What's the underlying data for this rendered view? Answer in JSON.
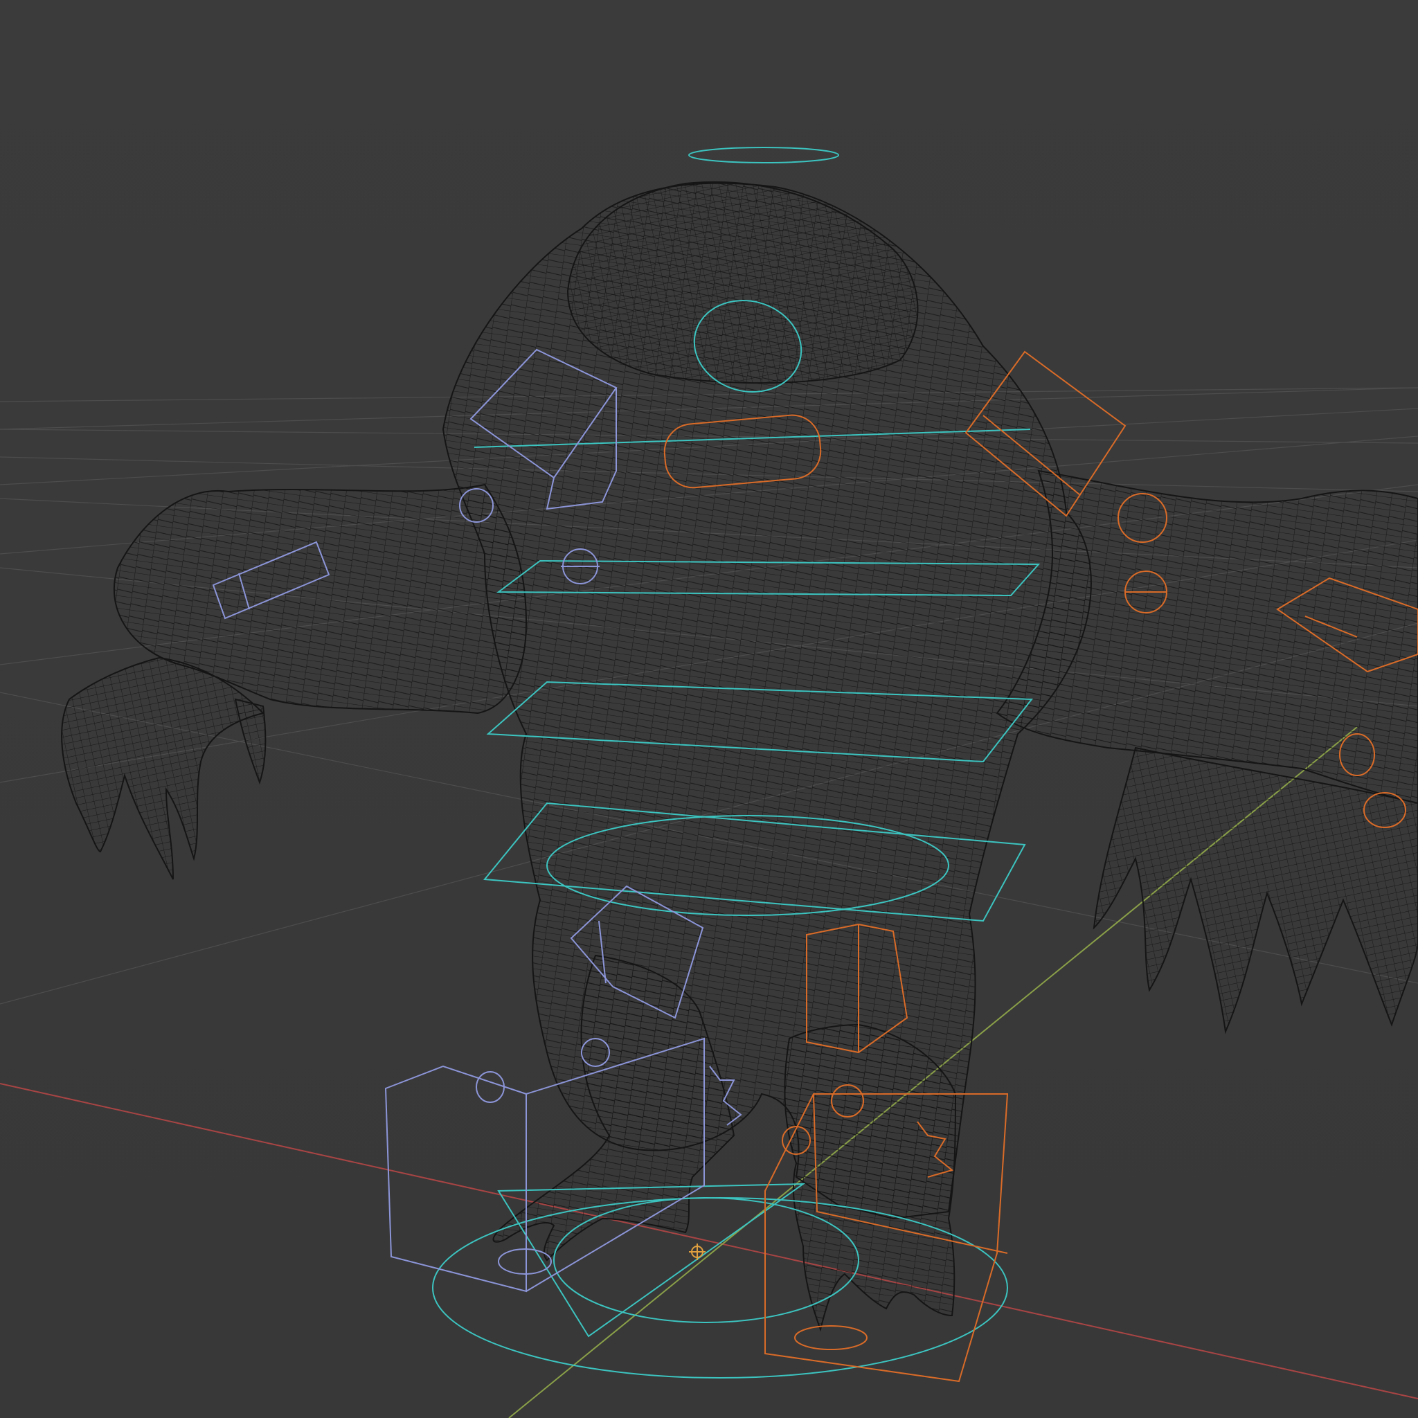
{
  "viewport": {
    "background": "#3a3a3a",
    "mode": "wireframe"
  },
  "colors": {
    "grid_line": "#4c4c4c",
    "axis_x": "#b04646",
    "axis_y": "#8aa24a",
    "mesh_wire": "#151515",
    "control_cyan": "#3cc4c0",
    "control_left_blue": "#8c95d8",
    "control_right_orange": "#d96b28",
    "origin_marker": "#e0a040"
  },
  "icons": {
    "origin": "3d-cursor-icon"
  }
}
